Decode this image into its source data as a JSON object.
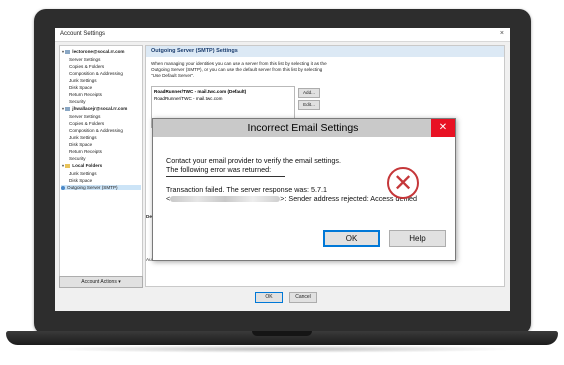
{
  "window": {
    "title": "Account Settings",
    "close_glyph": "×"
  },
  "tree": {
    "accounts": [
      {
        "name": "lectorone@socal.rr.com",
        "items": [
          "Server Settings",
          "Copies & Folders",
          "Composition & Addressing",
          "Junk Settings",
          "Disk Space",
          "Return Receipts",
          "Security"
        ]
      },
      {
        "name": "jhwallacejr@socal.rr.com",
        "items": [
          "Server Settings",
          "Copies & Folders",
          "Composition & Addressing",
          "Junk Settings",
          "Disk Space",
          "Return Receipts",
          "Security"
        ]
      }
    ],
    "local_folders": {
      "name": "Local Folders",
      "items": [
        "Junk Settings",
        "Disk Space"
      ]
    },
    "outgoing_server": "Outgoing Server (SMTP)",
    "account_actions": "Account Actions",
    "account_actions_caret": "▾"
  },
  "panel": {
    "header": "Outgoing Server (SMTP) Settings",
    "description": "When managing your identities you can use a server from this list by selecting it as the Outgoing Server (SMTP), or you can use the default server from this list by selecting \"Use Default Server\".",
    "servers": [
      "RoadRunner/TWC - mail.twc.com (Default)",
      "RoadRunner/TWC - mail.twc.com"
    ],
    "add_label": "Add...",
    "edit_label": "Edit...",
    "details_label": "Det",
    "auth_label": "Au"
  },
  "footer": {
    "ok_label": "OK",
    "cancel_label": "Cancel"
  },
  "dialog": {
    "title": "Incorrect Email Settings",
    "close_glyph": "✕",
    "line1": "Contact your email provider to verify the email settings.",
    "line2": "The following error was returned:",
    "line3": "Transaction failed. The server response was: 5.7.1",
    "line4_prefix": "<",
    "line4_suffix": ">: Sender address rejected: Access denied",
    "error_glyph": "✕",
    "ok_label": "OK",
    "help_label": "Help"
  },
  "colors": {
    "error_red": "#c5373a",
    "close_red": "#e81123",
    "header_blue": "#dce9f5",
    "focus_blue": "#0078d7"
  }
}
